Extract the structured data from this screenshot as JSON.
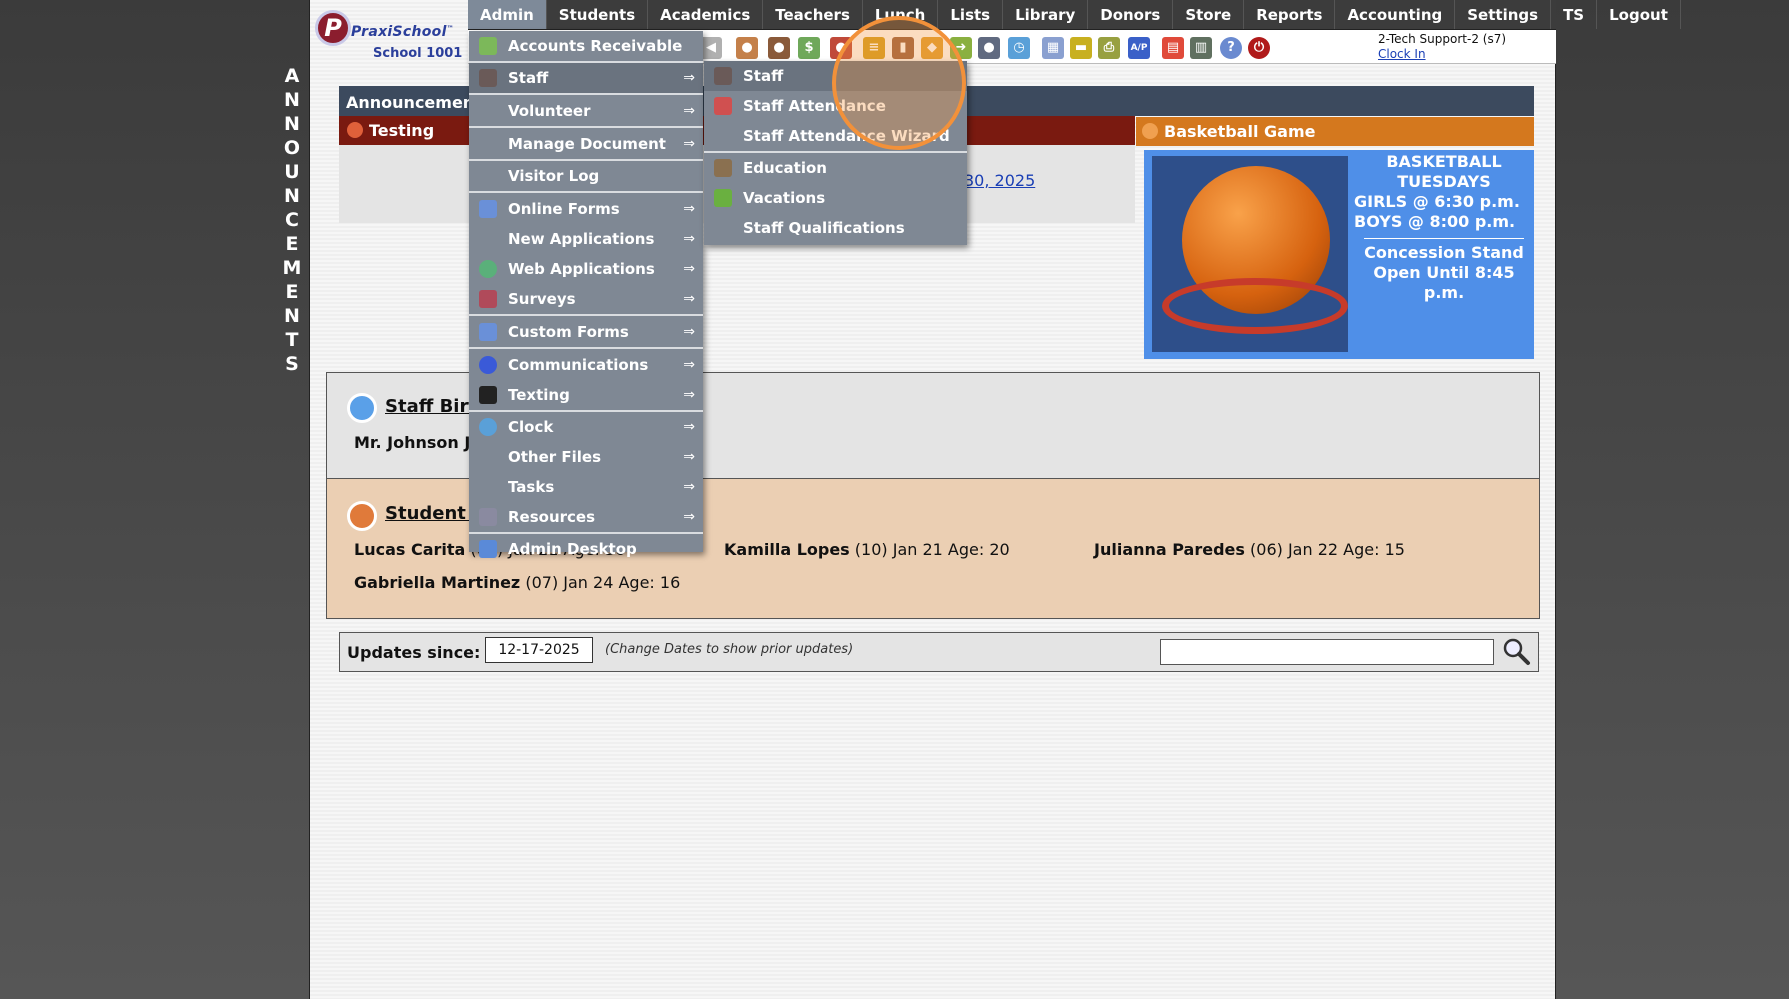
{
  "vertical_label": "ANNOUNCEMENTS",
  "logo": {
    "letter": "P",
    "brand": "PraxiSchool",
    "tm": "™",
    "school": "School 1001"
  },
  "topnav": [
    "Admin",
    "Students",
    "Academics",
    "Teachers",
    "Lunch",
    "Lists",
    "Library",
    "Donors",
    "Store",
    "Reports",
    "Accounting",
    "Settings",
    "TS",
    "Logout"
  ],
  "user": {
    "name": "2-Tech Support-2 (s7)",
    "clock_in": "Clock In"
  },
  "announcements": {
    "bar_title": "Announcements",
    "testing_title": "Testing",
    "testing_link": "30, 2025",
    "basketball_title": "Basketball Game",
    "basketball_lines": [
      "BASKETBALL",
      "TUESDAYS",
      "GIRLS @ 6:30 p.m.",
      "BOYS  @ 8:00 p.m."
    ],
    "concession_lines": [
      "Concession Stand",
      "Open Until 8:45 p.m."
    ]
  },
  "staff_birthdays": {
    "title": "Staff Birt",
    "entry": "Mr. Johnson J"
  },
  "student_birthdays": {
    "title": "Student B",
    "entries": [
      {
        "name": "Lucas Carita",
        "detail": "(09) Jan 21 Age: 36"
      },
      {
        "name": "Kamilla Lopes",
        "detail": "(10) Jan 21 Age: 20"
      },
      {
        "name": "Julianna Paredes",
        "detail": "(06) Jan 22 Age: 15"
      },
      {
        "name": "Gabriella Martinez",
        "detail": "(07) Jan 24 Age: 16"
      }
    ]
  },
  "updates": {
    "label": "Updates since:",
    "date": "12-17-2025",
    "note": "(Change Dates to show prior updates)",
    "search_value": ""
  },
  "admin_menu": [
    {
      "label": "Accounts Receivable",
      "arrow": false,
      "icon": "money-icon"
    },
    {
      "label": "Staff",
      "arrow": true,
      "icon": "staff-icon"
    },
    {
      "label": "Volunteer",
      "arrow": true,
      "icon": ""
    },
    {
      "label": "Manage Document",
      "arrow": true,
      "icon": ""
    },
    {
      "label": "Visitor Log",
      "arrow": false,
      "icon": ""
    },
    {
      "label": "Online Forms",
      "arrow": true,
      "icon": "html-icon"
    },
    {
      "label": "New Applications",
      "arrow": true,
      "icon": ""
    },
    {
      "label": "Web Applications",
      "arrow": true,
      "icon": "globe-icon"
    },
    {
      "label": "Surveys",
      "arrow": true,
      "icon": "survey-icon"
    },
    {
      "label": "Custom Forms",
      "arrow": true,
      "icon": "html-icon"
    },
    {
      "label": "Communications",
      "arrow": true,
      "icon": "at-icon"
    },
    {
      "label": "Texting",
      "arrow": true,
      "icon": "phone-icon"
    },
    {
      "label": "Clock",
      "arrow": true,
      "icon": "clock-icon"
    },
    {
      "label": "Other Files",
      "arrow": true,
      "icon": ""
    },
    {
      "label": "Tasks",
      "arrow": true,
      "icon": ""
    },
    {
      "label": "Resources",
      "arrow": true,
      "icon": "resources-icon"
    },
    {
      "label": "Admin Desktop",
      "arrow": false,
      "icon": "desktop-icon"
    }
  ],
  "arrow_glyph": "⇒",
  "staff_menu": [
    {
      "label": "Staff",
      "icon": "staff-icon"
    },
    {
      "label": "Staff Attendance",
      "icon": "calendar-icon"
    },
    {
      "label": "Staff Attendance Wizard",
      "icon": ""
    },
    {
      "label": "Education",
      "icon": "education-icon"
    },
    {
      "label": "Vacations",
      "icon": "vacation-icon"
    },
    {
      "label": "Staff Qualifications",
      "icon": ""
    }
  ],
  "colors": {
    "nav_bg": "#3c3c3c",
    "menu_bg": "#7f8894",
    "announcement_bar": "#3c4a5e",
    "testing_bar": "#7a1a10",
    "basketball_header": "#d4781e",
    "basketball_panel": "#4f8fe8",
    "student_bday_bg": "#ebcfb3",
    "highlight": "#f2913a"
  }
}
